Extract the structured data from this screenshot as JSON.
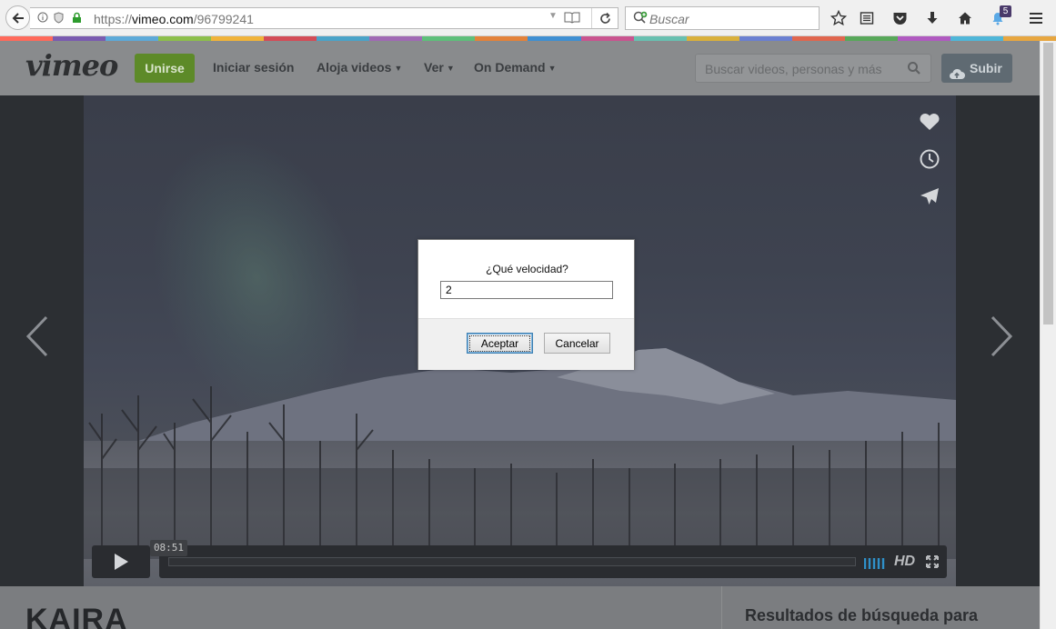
{
  "browser": {
    "url_protocol": "https://",
    "url_host": "vimeo.com",
    "url_path": "/96799241",
    "search_placeholder": "Buscar",
    "notification_count": "5",
    "stripe_colors": [
      "#ff6a5b",
      "#7a5bb0",
      "#5ca9d8",
      "#8cbf4b",
      "#f0b33a",
      "#d34c57",
      "#4aa3c8",
      "#a06ab4",
      "#5ebf7a",
      "#e3823a",
      "#3f8fd2",
      "#c9548f",
      "#68c0b0",
      "#d9b03b",
      "#6a7fd1",
      "#e0664e",
      "#58a85a",
      "#b05ac0",
      "#4fb6d8",
      "#e7a640"
    ]
  },
  "site": {
    "logo": "vimeo",
    "join_label": "Unirse",
    "nav": {
      "login": "Iniciar sesión",
      "host_videos": "Aloja videos",
      "watch": "Ver",
      "on_demand": "On Demand"
    },
    "search_placeholder": "Buscar videos, personas y más",
    "upload_label": "Subir",
    "accent_color": "#5d8a28"
  },
  "player": {
    "time": "08:51",
    "hd_label": "HD"
  },
  "content": {
    "video_title": "KAIRA",
    "sidebar_heading": "Resultados de búsqueda para"
  },
  "dialog": {
    "message": "¿Qué velocidad?",
    "input_value": "2",
    "accept_label": "Aceptar",
    "cancel_label": "Cancelar"
  }
}
